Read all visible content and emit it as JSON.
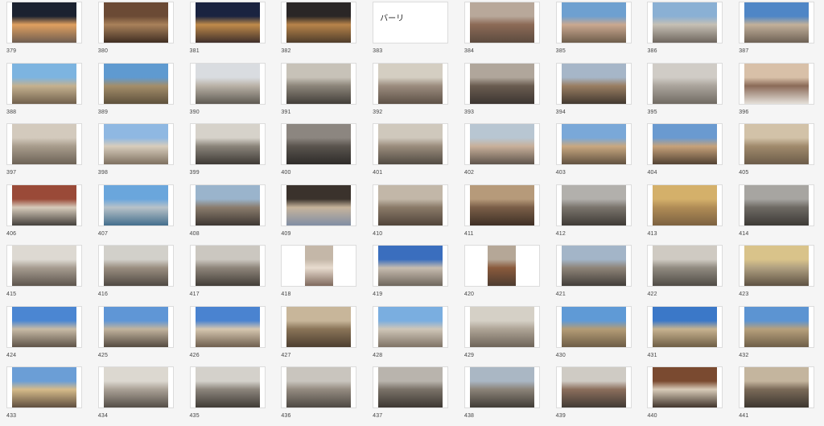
{
  "grid": {
    "rows": [
      [
        {
          "label": "379",
          "kind": "photo",
          "colors": [
            "#1b2230",
            "#e0a060",
            "#6a5a50"
          ]
        },
        {
          "label": "380",
          "kind": "photo",
          "colors": [
            "#6b4a35",
            "#a9815a",
            "#3b2a20"
          ]
        },
        {
          "label": "381",
          "kind": "photo",
          "colors": [
            "#1a2340",
            "#c08b4a",
            "#3a2b2a"
          ]
        },
        {
          "label": "382",
          "kind": "photo",
          "colors": [
            "#2a2626",
            "#b8844a",
            "#4b3a2a"
          ]
        },
        {
          "label": "383",
          "kind": "text",
          "text": "バーリ"
        },
        {
          "label": "384",
          "kind": "photo",
          "colors": [
            "#b8a89a",
            "#8c6a56",
            "#5a4a3e"
          ]
        },
        {
          "label": "385",
          "kind": "photo",
          "colors": [
            "#6ea0d0",
            "#caa890",
            "#6a5a48"
          ]
        },
        {
          "label": "386",
          "kind": "photo",
          "colors": [
            "#8ab0d4",
            "#c6c0b4",
            "#6a625a"
          ]
        },
        {
          "label": "387",
          "kind": "photo",
          "colors": [
            "#4f86c6",
            "#c2b09a",
            "#6a5e52"
          ]
        }
      ],
      [
        {
          "label": "388",
          "kind": "photo",
          "colors": [
            "#7db4e0",
            "#c5b18f",
            "#6d5d4a"
          ]
        },
        {
          "label": "389",
          "kind": "photo",
          "colors": [
            "#5f9ad0",
            "#a48e6a",
            "#5b4e3a"
          ]
        },
        {
          "label": "390",
          "kind": "photo",
          "colors": [
            "#d9dce0",
            "#b9b2a6",
            "#5a554e"
          ]
        },
        {
          "label": "391",
          "kind": "photo",
          "colors": [
            "#c7c2b8",
            "#8c857a",
            "#3f3b36"
          ]
        },
        {
          "label": "392",
          "kind": "photo",
          "colors": [
            "#d4cec2",
            "#9b8c7e",
            "#5a4e44"
          ]
        },
        {
          "label": "393",
          "kind": "photo",
          "colors": [
            "#b0a69b",
            "#6a5c50",
            "#3a3430"
          ]
        },
        {
          "label": "394",
          "kind": "photo",
          "colors": [
            "#a6b6c8",
            "#9a7e62",
            "#3e362e"
          ]
        },
        {
          "label": "395",
          "kind": "photo",
          "colors": [
            "#d0ccc6",
            "#aaa49c",
            "#6e6860"
          ]
        },
        {
          "label": "396",
          "kind": "photo",
          "colors": [
            "#d8c0a8",
            "#8a6a58",
            "#e9e5df"
          ]
        }
      ],
      [
        {
          "label": "397",
          "kind": "photo",
          "colors": [
            "#d3cabd",
            "#a89c8c",
            "#6a6054"
          ]
        },
        {
          "label": "398",
          "kind": "photo",
          "colors": [
            "#8fb8e2",
            "#d8cdbc",
            "#7a6c5c"
          ]
        },
        {
          "label": "399",
          "kind": "photo",
          "colors": [
            "#d6d2ca",
            "#8a847a",
            "#3a3632"
          ]
        },
        {
          "label": "400",
          "kind": "photo",
          "colors": [
            "#8c8680",
            "#5a544e",
            "#2c2a28"
          ]
        },
        {
          "label": "401",
          "kind": "photo",
          "colors": [
            "#cfc8bc",
            "#9a8c7c",
            "#4e4840"
          ]
        },
        {
          "label": "402",
          "kind": "photo",
          "colors": [
            "#b8c6d2",
            "#c8b09a",
            "#5a5048"
          ]
        },
        {
          "label": "403",
          "kind": "photo",
          "colors": [
            "#7aa8d8",
            "#c9a880",
            "#5d4e3e"
          ]
        },
        {
          "label": "404",
          "kind": "photo",
          "colors": [
            "#6a9ad0",
            "#c7a27a",
            "#4d3e30"
          ]
        },
        {
          "label": "405",
          "kind": "photo",
          "colors": [
            "#d2c2a8",
            "#a08a6c",
            "#6a5a48"
          ]
        }
      ],
      [
        {
          "label": "406",
          "kind": "photo",
          "colors": [
            "#9a4a38",
            "#d6cbbb",
            "#3e3a36"
          ]
        },
        {
          "label": "407",
          "kind": "photo",
          "colors": [
            "#6aa6dc",
            "#b8c2c8",
            "#3e6a8a"
          ]
        },
        {
          "label": "408",
          "kind": "photo",
          "colors": [
            "#9ab4cc",
            "#8a7c6c",
            "#3a3430"
          ]
        },
        {
          "label": "409",
          "kind": "photo",
          "colors": [
            "#3a322c",
            "#c6b49c",
            "#7d8ca4"
          ]
        },
        {
          "label": "410",
          "kind": "photo",
          "colors": [
            "#c2b7a8",
            "#8a7a68",
            "#4e4238"
          ]
        },
        {
          "label": "411",
          "kind": "photo",
          "colors": [
            "#b69a7a",
            "#7a5e48",
            "#3c2e24"
          ]
        },
        {
          "label": "412",
          "kind": "photo",
          "colors": [
            "#b2b0ac",
            "#7a746c",
            "#3c3834"
          ]
        },
        {
          "label": "413",
          "kind": "photo",
          "colors": [
            "#d4b06a",
            "#b08c56",
            "#7a6040"
          ]
        },
        {
          "label": "414",
          "kind": "photo",
          "colors": [
            "#a7a5a1",
            "#6e6a64",
            "#3b3834"
          ]
        }
      ],
      [
        {
          "label": "415",
          "kind": "photo",
          "colors": [
            "#ddd9d2",
            "#a69c90",
            "#5a524a"
          ]
        },
        {
          "label": "416",
          "kind": "photo",
          "colors": [
            "#d2d0ca",
            "#9a8e80",
            "#4c4640"
          ]
        },
        {
          "label": "417",
          "kind": "photo",
          "colors": [
            "#cbc7c0",
            "#8e857a",
            "#3f3a35"
          ]
        },
        {
          "label": "418",
          "kind": "portrait",
          "colors": [
            "#c4b7a8",
            "#e8dccf",
            "#7a6458"
          ]
        },
        {
          "label": "419",
          "kind": "photo",
          "colors": [
            "#3a6ebe",
            "#c7bdb0",
            "#6a6258"
          ]
        },
        {
          "label": "420",
          "kind": "portrait",
          "colors": [
            "#b5a797",
            "#8a5a3c",
            "#4b3b30"
          ]
        },
        {
          "label": "421",
          "kind": "photo",
          "colors": [
            "#a3b5c8",
            "#8e8478",
            "#3f3b37"
          ]
        },
        {
          "label": "422",
          "kind": "photo",
          "colors": [
            "#cfcac2",
            "#908a80",
            "#4d4943"
          ]
        },
        {
          "label": "423",
          "kind": "photo",
          "colors": [
            "#d9c38a",
            "#b0a080",
            "#5a4e40"
          ]
        }
      ],
      [
        {
          "label": "424",
          "kind": "photo",
          "colors": [
            "#4b86d2",
            "#c8bba6",
            "#5a4f44"
          ]
        },
        {
          "label": "425",
          "kind": "photo",
          "colors": [
            "#5f96d6",
            "#c2b49e",
            "#4f453c"
          ]
        },
        {
          "label": "426",
          "kind": "photo",
          "colors": [
            "#4a83d0",
            "#d6c7b0",
            "#6a5a4a"
          ]
        },
        {
          "label": "427",
          "kind": "photo",
          "colors": [
            "#c8b69a",
            "#8a7458",
            "#4a3c2e"
          ]
        },
        {
          "label": "428",
          "kind": "photo",
          "colors": [
            "#7aaee0",
            "#cfc6b8",
            "#7b6f62"
          ]
        },
        {
          "label": "429",
          "kind": "photo",
          "colors": [
            "#d5d0c6",
            "#aea496",
            "#6b6156"
          ]
        },
        {
          "label": "430",
          "kind": "photo",
          "colors": [
            "#5f9ad6",
            "#b49c76",
            "#6a5a44"
          ]
        },
        {
          "label": "431",
          "kind": "photo",
          "colors": [
            "#3b78c8",
            "#c7b390",
            "#6a5a42"
          ]
        },
        {
          "label": "432",
          "kind": "photo",
          "colors": [
            "#5c94d2",
            "#b7a07c",
            "#6b5c46"
          ]
        }
      ],
      [
        {
          "label": "433",
          "kind": "photo",
          "colors": [
            "#6b9ed6",
            "#d6bb8a",
            "#5a4a3c"
          ]
        },
        {
          "label": "434",
          "kind": "photo",
          "colors": [
            "#dcd8d0",
            "#aaa196",
            "#504a44"
          ]
        },
        {
          "label": "435",
          "kind": "photo",
          "colors": [
            "#d4d1cb",
            "#8c857c",
            "#3c3833"
          ]
        },
        {
          "label": "436",
          "kind": "photo",
          "colors": [
            "#c9c5be",
            "#948b80",
            "#4a4540"
          ]
        },
        {
          "label": "437",
          "kind": "photo",
          "colors": [
            "#b9b4ad",
            "#7a7268",
            "#3a3530"
          ]
        },
        {
          "label": "438",
          "kind": "photo",
          "colors": [
            "#aab7c4",
            "#8b8378",
            "#3d3934"
          ]
        },
        {
          "label": "439",
          "kind": "photo",
          "colors": [
            "#cfcbc4",
            "#8b6e5c",
            "#3e3833"
          ]
        },
        {
          "label": "440",
          "kind": "photo",
          "colors": [
            "#7a4a30",
            "#d8cbb8",
            "#3a2e26"
          ]
        },
        {
          "label": "441",
          "kind": "photo",
          "colors": [
            "#c4b59e",
            "#7a6a58",
            "#3a342e"
          ]
        }
      ]
    ]
  }
}
